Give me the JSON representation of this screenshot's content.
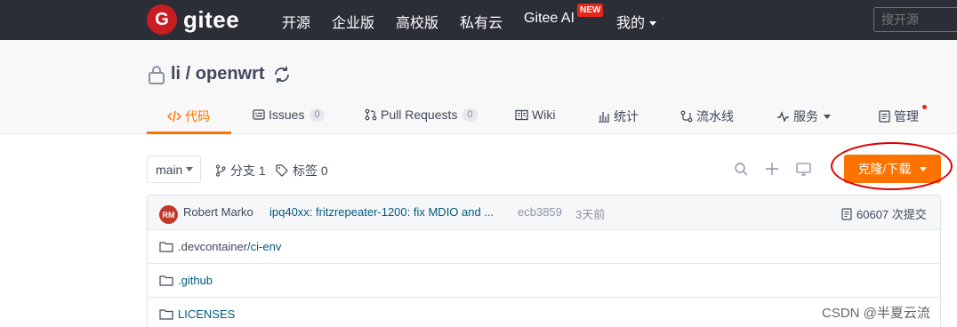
{
  "nav": {
    "logo_letter": "G",
    "logo_text": "gitee",
    "items": [
      "开源",
      "企业版",
      "高校版",
      "私有云",
      "Gitee AI",
      "我的"
    ],
    "new_badge": "NEW",
    "search_placeholder": "搜开源"
  },
  "project": {
    "title": "li / openwrt",
    "tabs": [
      {
        "label": "代码",
        "icon": "code-icon"
      },
      {
        "label": "Issues",
        "count": "0",
        "icon": "issue-icon"
      },
      {
        "label": "Pull Requests",
        "count": "0",
        "icon": "pull-request-icon"
      },
      {
        "label": "Wiki",
        "icon": "wiki-icon"
      },
      {
        "label": "统计",
        "icon": "stats-icon"
      },
      {
        "label": "流水线",
        "icon": "pipeline-icon"
      },
      {
        "label": "服务",
        "icon": "pulse-icon"
      },
      {
        "label": "管理",
        "icon": "manage-icon"
      }
    ]
  },
  "toolbar": {
    "branch": "main",
    "branches": "分支 1",
    "tags": "标签 0",
    "clone_label": "克隆/下载"
  },
  "commit": {
    "avatar": "RM",
    "author": "Robert Marko",
    "message": "ipq40xx: fritzrepeater-1200: fix MDIO and ...",
    "hash": "ecb3859",
    "time": "3天前",
    "count": "60607 次提交"
  },
  "files": [
    {
      "prefix": ".devcontainer/",
      "name": "ci-env"
    },
    {
      "prefix": "",
      "name": ".github"
    },
    {
      "prefix": "",
      "name": "LICENSES"
    }
  ],
  "watermark": "CSDN @半夏云流",
  "colors": {
    "accent": "#fe7300",
    "nav_bg": "#2b2e36",
    "brand": "#c71d23"
  }
}
